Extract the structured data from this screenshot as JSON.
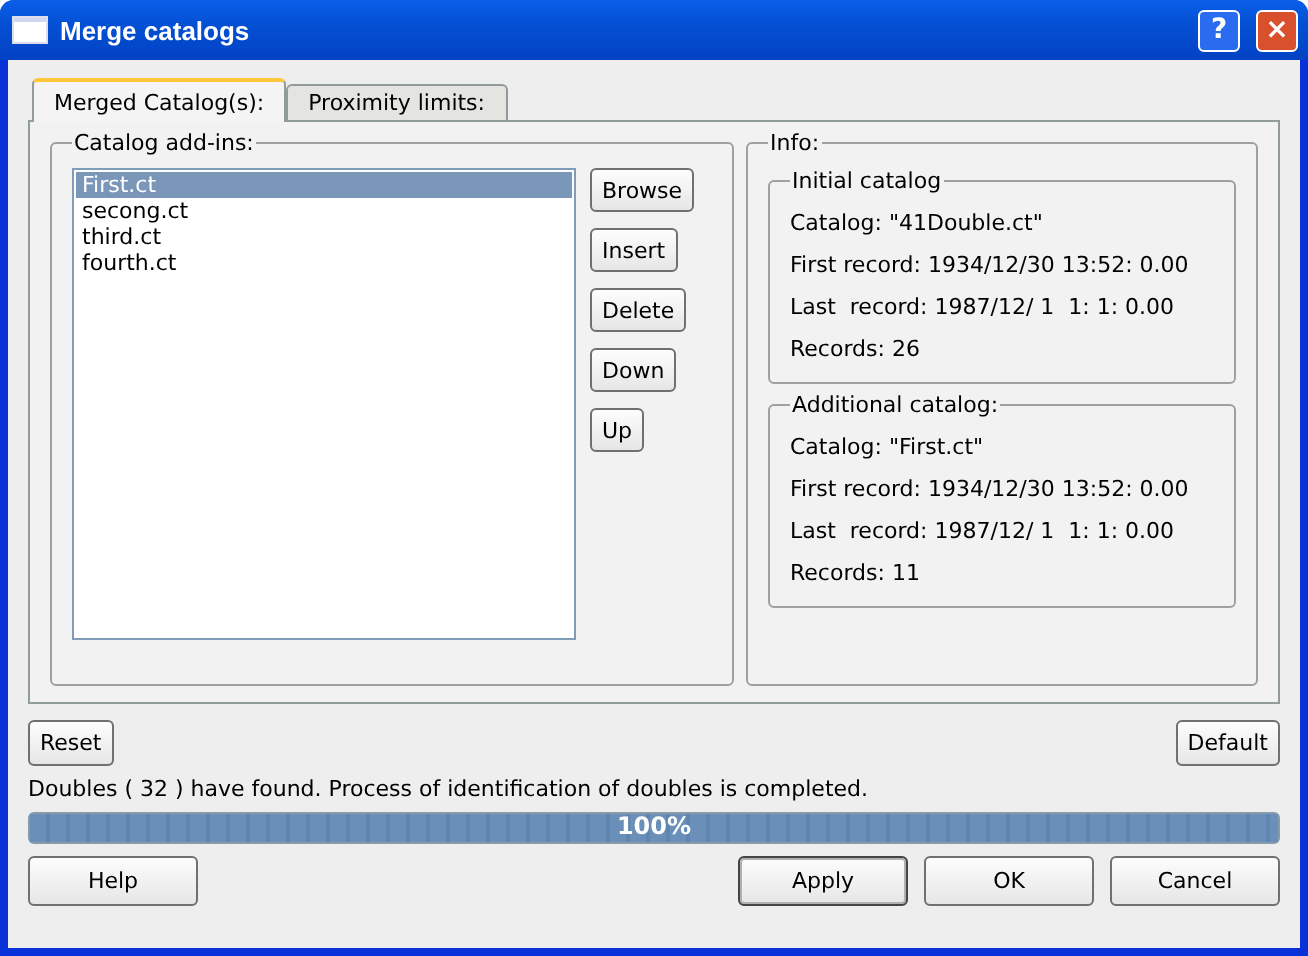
{
  "window": {
    "title": "Merge catalogs",
    "controls": [
      "?",
      "×"
    ]
  },
  "tabs": [
    {
      "label": "Merged Catalog(s):",
      "selected": true
    },
    {
      "label": "Proximity limits:",
      "selected": false
    }
  ],
  "catalog_addins": {
    "title": "Catalog add-ins:",
    "items": [
      {
        "label": "First.ct",
        "selected": true
      },
      {
        "label": "secong.ct",
        "selected": false
      },
      {
        "label": "third.ct",
        "selected": false
      },
      {
        "label": "fourth.ct",
        "selected": false
      }
    ],
    "buttons": [
      "Browse",
      "Insert",
      "Delete",
      "Down",
      "Up"
    ]
  },
  "info": {
    "title": "Info:",
    "sections": [
      {
        "title": "Initial catalog",
        "lines": [
          "Catalog: \"41Double.ct\"",
          "First record: 1934/12/30 13:52: 0.00",
          "Last  record: 1987/12/ 1  1: 1: 0.00",
          "Records: 26"
        ]
      },
      {
        "title": "Additional catalog:",
        "lines": [
          "Catalog: \"First.ct\"",
          "First record: 1934/12/30 13:52: 0.00",
          "Last  record: 1987/12/ 1  1: 1: 0.00",
          "Records: 11"
        ]
      }
    ]
  },
  "reset_button": "Reset",
  "default_button": "Default",
  "status": "Doubles ( 32 ) have found. Process of identification of doubles is completed.",
  "progress": {
    "level": 1,
    "label": "100%"
  },
  "buttons": [
    {
      "label": "Help",
      "default": false
    },
    {
      "label": "Apply",
      "default": true
    },
    {
      "label": "OK",
      "default": false
    },
    {
      "label": "Cancel",
      "default": false
    }
  ]
}
